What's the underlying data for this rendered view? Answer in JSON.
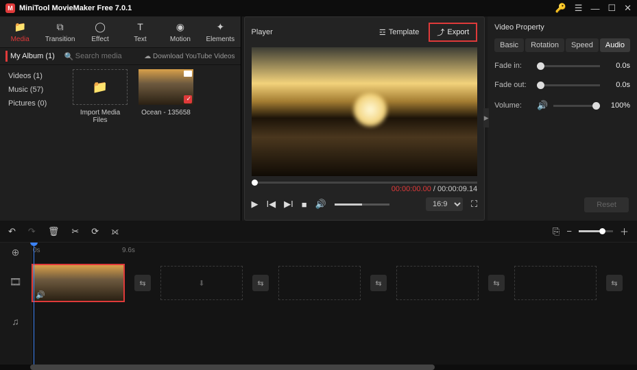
{
  "app": {
    "title": "MiniTool MovieMaker Free 7.0.1"
  },
  "toolbar": {
    "media": "Media",
    "transition": "Transition",
    "effect": "Effect",
    "text": "Text",
    "motion": "Motion",
    "elements": "Elements"
  },
  "media": {
    "albumLabel": "My Album (1)",
    "searchPlaceholder": "Search media",
    "downloadLabel": "Download YouTube Videos",
    "categories": {
      "videos": "Videos (1)",
      "music": "Music (57)",
      "pictures": "Pictures (0)"
    },
    "importLabel": "Import Media Files",
    "clipLabel": "Ocean - 135658"
  },
  "player": {
    "title": "Player",
    "templateLabel": "Template",
    "exportLabel": "Export",
    "currentTime": "00:00:00.00",
    "duration": "00:00:09.14",
    "aspect": "16:9"
  },
  "props": {
    "title": "Video Property",
    "tabs": {
      "basic": "Basic",
      "rotation": "Rotation",
      "speed": "Speed",
      "audio": "Audio"
    },
    "fadeInLabel": "Fade in:",
    "fadeInVal": "0.0s",
    "fadeOutLabel": "Fade out:",
    "fadeOutVal": "0.0s",
    "volumeLabel": "Volume:",
    "volumeVal": "100%",
    "resetLabel": "Reset"
  },
  "timeline": {
    "ruler": {
      "t0": "0s",
      "t1": "9.6s"
    }
  }
}
